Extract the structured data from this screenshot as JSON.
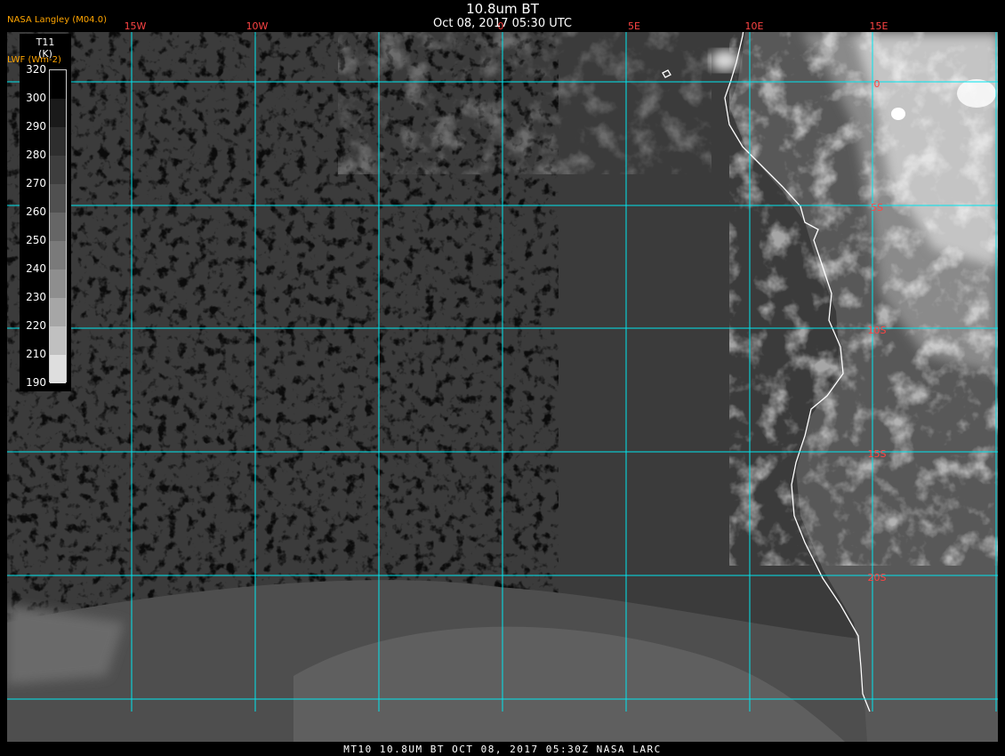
{
  "header": {
    "title": "10.8um BT",
    "subtitle": "Oct 08, 2017 05:30 UTC",
    "org": "NASA Langley (M04.0)"
  },
  "footer": {
    "text": "MT10  10.8UM BT  OCT 08, 2017 05:30Z  NASA LARC"
  },
  "legend": {
    "title": "T11",
    "unit": "(K)",
    "sub_label": "LWF (Wm-2)",
    "values": [
      "320",
      "300",
      "290",
      "280",
      "270",
      "260",
      "250",
      "240",
      "230",
      "220",
      "210",
      "190"
    ],
    "colors": [
      "#000000",
      "#1a1a1a",
      "#2e2e2e",
      "#3e3e3e",
      "#505050",
      "#666666",
      "#7a7a7a",
      "#8e8e8e",
      "#a6a6a6",
      "#c0c0c0",
      "#dedede",
      "#ffffff"
    ]
  },
  "map": {
    "longitude_labels": [
      "15W",
      "10W",
      "0",
      "5E",
      "10E",
      "15E"
    ],
    "latitude_labels": [
      "0",
      "5S",
      "10S",
      "15S",
      "20S"
    ],
    "grid_color": "#00e5ee",
    "lon_label_color": "#ff4444",
    "lat_label_color": "#ff4444"
  }
}
